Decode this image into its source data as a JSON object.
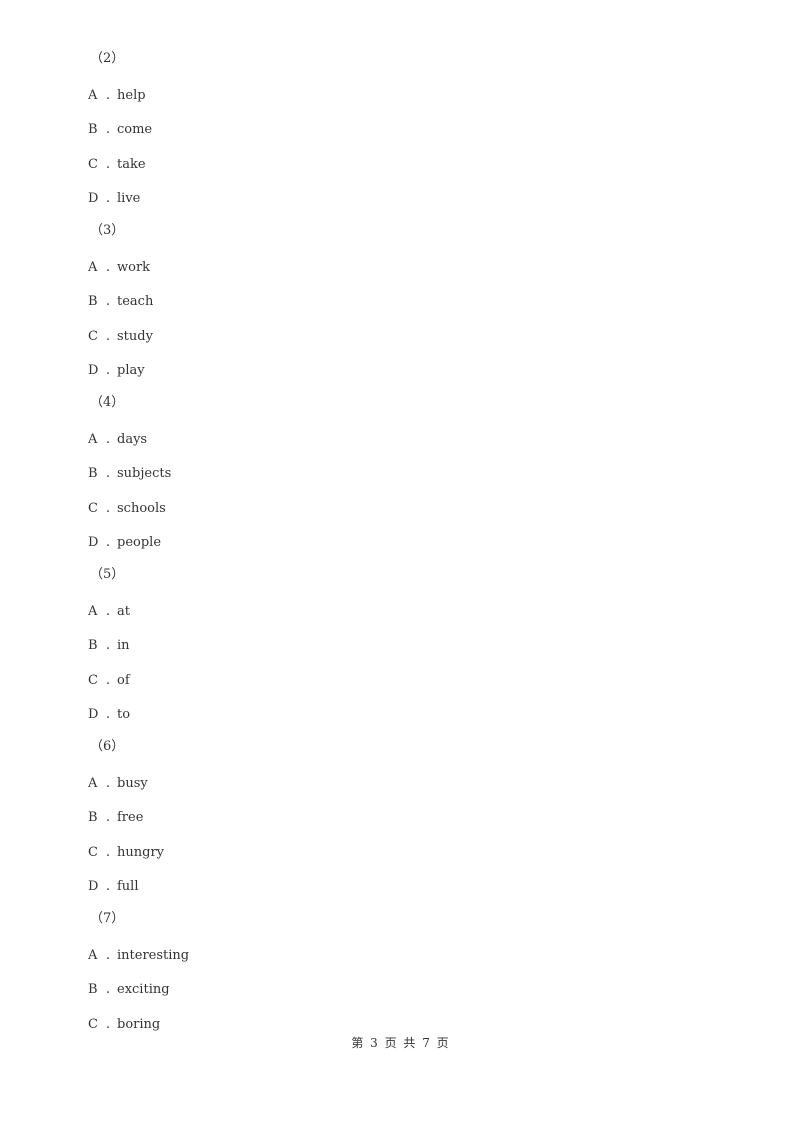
{
  "questions": [
    {
      "number": "（2）",
      "options": [
        {
          "letter": "A",
          "text": "help"
        },
        {
          "letter": "B",
          "text": "come"
        },
        {
          "letter": "C",
          "text": "take"
        },
        {
          "letter": "D",
          "text": "live"
        }
      ]
    },
    {
      "number": "（3）",
      "options": [
        {
          "letter": "A",
          "text": "work"
        },
        {
          "letter": "B",
          "text": "teach"
        },
        {
          "letter": "C",
          "text": "study"
        },
        {
          "letter": "D",
          "text": "play"
        }
      ]
    },
    {
      "number": "（4）",
      "options": [
        {
          "letter": "A",
          "text": "days"
        },
        {
          "letter": "B",
          "text": "subjects"
        },
        {
          "letter": "C",
          "text": "schools"
        },
        {
          "letter": "D",
          "text": "people"
        }
      ]
    },
    {
      "number": "（5）",
      "options": [
        {
          "letter": "A",
          "text": "at"
        },
        {
          "letter": "B",
          "text": "in"
        },
        {
          "letter": "C",
          "text": "of"
        },
        {
          "letter": "D",
          "text": "to"
        }
      ]
    },
    {
      "number": "（6）",
      "options": [
        {
          "letter": "A",
          "text": "busy"
        },
        {
          "letter": "B",
          "text": "free"
        },
        {
          "letter": "C",
          "text": "hungry"
        },
        {
          "letter": "D",
          "text": "full"
        }
      ]
    },
    {
      "number": "（7）",
      "options": [
        {
          "letter": "A",
          "text": "interesting"
        },
        {
          "letter": "B",
          "text": "exciting"
        },
        {
          "letter": "C",
          "text": "boring"
        }
      ]
    }
  ],
  "option_separator": ".",
  "footer": {
    "text": "第 3 页 共 7 页"
  }
}
